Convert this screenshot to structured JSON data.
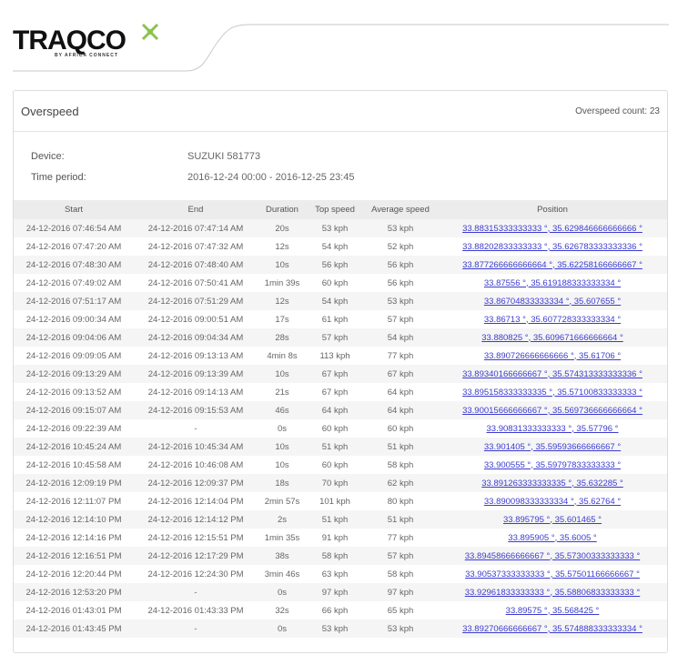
{
  "brand": {
    "logo_text": "TRAQCO",
    "logo_tagline": "BY AFRICA CONNECT"
  },
  "report": {
    "title": "Overspeed",
    "count_label": "Overspeed count: 23",
    "device_label": "Device:",
    "device_value": "SUZUKI 581773",
    "period_label": "Time period:",
    "period_value": "2016-12-24 00:00 - 2016-12-25 23:45"
  },
  "table": {
    "columns": [
      "Start",
      "End",
      "Duration",
      "Top speed",
      "Average speed",
      "Position"
    ],
    "rows": [
      [
        "24-12-2016 07:46:54 AM",
        "24-12-2016 07:47:14 AM",
        "20s",
        "53 kph",
        "53 kph",
        "33.88315333333333 °, 35.629846666666666 °"
      ],
      [
        "24-12-2016 07:47:20 AM",
        "24-12-2016 07:47:32 AM",
        "12s",
        "54 kph",
        "52 kph",
        "33.88202833333333 °, 35.626783333333336 °"
      ],
      [
        "24-12-2016 07:48:30 AM",
        "24-12-2016 07:48:40 AM",
        "10s",
        "56 kph",
        "56 kph",
        "33.877266666666664 °, 35.62258166666667 °"
      ],
      [
        "24-12-2016 07:49:02 AM",
        "24-12-2016 07:50:41 AM",
        "1min 39s",
        "60 kph",
        "56 kph",
        "33.87556 °, 35.619188333333334 °"
      ],
      [
        "24-12-2016 07:51:17 AM",
        "24-12-2016 07:51:29 AM",
        "12s",
        "54 kph",
        "53 kph",
        "33.86704833333334 °, 35.607655 °"
      ],
      [
        "24-12-2016 09:00:34 AM",
        "24-12-2016 09:00:51 AM",
        "17s",
        "61 kph",
        "57 kph",
        "33.86713 °, 35.607728333333334 °"
      ],
      [
        "24-12-2016 09:04:06 AM",
        "24-12-2016 09:04:34 AM",
        "28s",
        "57 kph",
        "54 kph",
        "33.880825 °, 35.609671666666664 °"
      ],
      [
        "24-12-2016 09:09:05 AM",
        "24-12-2016 09:13:13 AM",
        "4min 8s",
        "113 kph",
        "77 kph",
        "33.890726666666666 °, 35.61706 °"
      ],
      [
        "24-12-2016 09:13:29 AM",
        "24-12-2016 09:13:39 AM",
        "10s",
        "67 kph",
        "67 kph",
        "33.89340166666667 °, 35.574313333333336 °"
      ],
      [
        "24-12-2016 09:13:52 AM",
        "24-12-2016 09:14:13 AM",
        "21s",
        "67 kph",
        "64 kph",
        "33.895158333333335 °, 35.57100833333333 °"
      ],
      [
        "24-12-2016 09:15:07 AM",
        "24-12-2016 09:15:53 AM",
        "46s",
        "64 kph",
        "64 kph",
        "33.90015666666667 °, 35.569736666666664 °"
      ],
      [
        "24-12-2016 09:22:39 AM",
        "-",
        "0s",
        "60 kph",
        "60 kph",
        "33.90831333333333 °, 35.57796 °"
      ],
      [
        "24-12-2016 10:45:24 AM",
        "24-12-2016 10:45:34 AM",
        "10s",
        "51 kph",
        "51 kph",
        "33.901405 °, 35.59593666666667 °"
      ],
      [
        "24-12-2016 10:45:58 AM",
        "24-12-2016 10:46:08 AM",
        "10s",
        "60 kph",
        "58 kph",
        "33.900555 °, 35.59797833333333 °"
      ],
      [
        "24-12-2016 12:09:19 PM",
        "24-12-2016 12:09:37 PM",
        "18s",
        "70 kph",
        "62 kph",
        "33.891263333333335 °, 35.632285 °"
      ],
      [
        "24-12-2016 12:11:07 PM",
        "24-12-2016 12:14:04 PM",
        "2min 57s",
        "101 kph",
        "80 kph",
        "33.890098333333334 °, 35.62764 °"
      ],
      [
        "24-12-2016 12:14:10 PM",
        "24-12-2016 12:14:12 PM",
        "2s",
        "51 kph",
        "51 kph",
        "33.895795 °, 35.601465 °"
      ],
      [
        "24-12-2016 12:14:16 PM",
        "24-12-2016 12:15:51 PM",
        "1min 35s",
        "91 kph",
        "77 kph",
        "33.895905 °, 35.6005 °"
      ],
      [
        "24-12-2016 12:16:51 PM",
        "24-12-2016 12:17:29 PM",
        "38s",
        "58 kph",
        "57 kph",
        "33.89458666666667 °, 35.57300333333333 °"
      ],
      [
        "24-12-2016 12:20:44 PM",
        "24-12-2016 12:24:30 PM",
        "3min 46s",
        "63 kph",
        "58 kph",
        "33.90537333333333 °, 35.57501166666667 °"
      ],
      [
        "24-12-2016 12:53:20 PM",
        "-",
        "0s",
        "97 kph",
        "97 kph",
        "33.92961833333333 °, 35.58806833333333 °"
      ],
      [
        "24-12-2016 01:43:01 PM",
        "24-12-2016 01:43:33 PM",
        "32s",
        "66 kph",
        "65 kph",
        "33.89575 °, 35.568425 °"
      ],
      [
        "24-12-2016 01:43:45 PM",
        "-",
        "0s",
        "53 kph",
        "53 kph",
        "33.89270666666667 °, 35.574888333333334 °"
      ]
    ]
  },
  "colors": {
    "link": "#3b3bd0",
    "header_bg": "#ececec",
    "row_alt": "#f5f5f5",
    "logo_green": "#8bc34a"
  }
}
